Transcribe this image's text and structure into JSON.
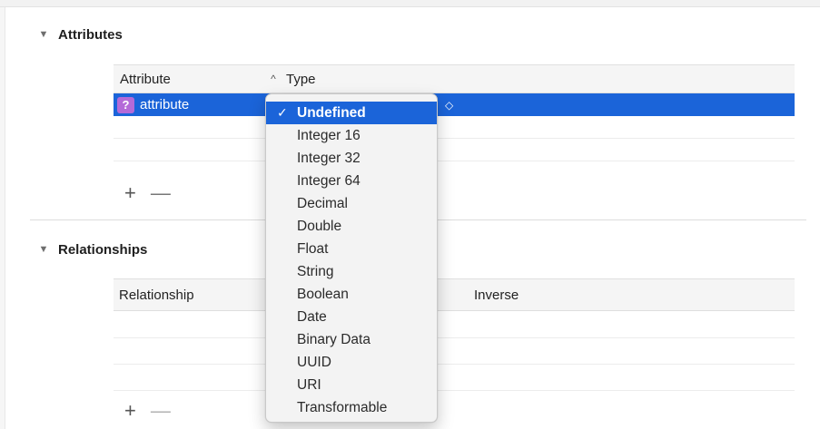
{
  "attributes": {
    "title": "Attributes",
    "columns": {
      "attribute": "Attribute",
      "type": "Type"
    },
    "rows": [
      {
        "badge": "?",
        "name": "attribute",
        "type": "Undefined"
      }
    ],
    "add_label": "+",
    "remove_label": "—"
  },
  "relationships": {
    "title": "Relationships",
    "columns": {
      "relationship": "Relationship",
      "inverse": "Inverse"
    },
    "add_label": "+",
    "remove_label": "—"
  },
  "type_menu": {
    "check": "✓",
    "selected": "Undefined",
    "options": [
      "Undefined",
      "Integer 16",
      "Integer 32",
      "Integer 64",
      "Decimal",
      "Double",
      "Float",
      "String",
      "Boolean",
      "Date",
      "Binary Data",
      "UUID",
      "URI",
      "Transformable"
    ]
  },
  "icons": {
    "disclosure": "triangle-down-icon",
    "sort": "chevron-up-icon",
    "stepper": "updown-chevron-icon"
  },
  "colors": {
    "selection": "#1b64d9",
    "badge": "#b46ad8"
  }
}
